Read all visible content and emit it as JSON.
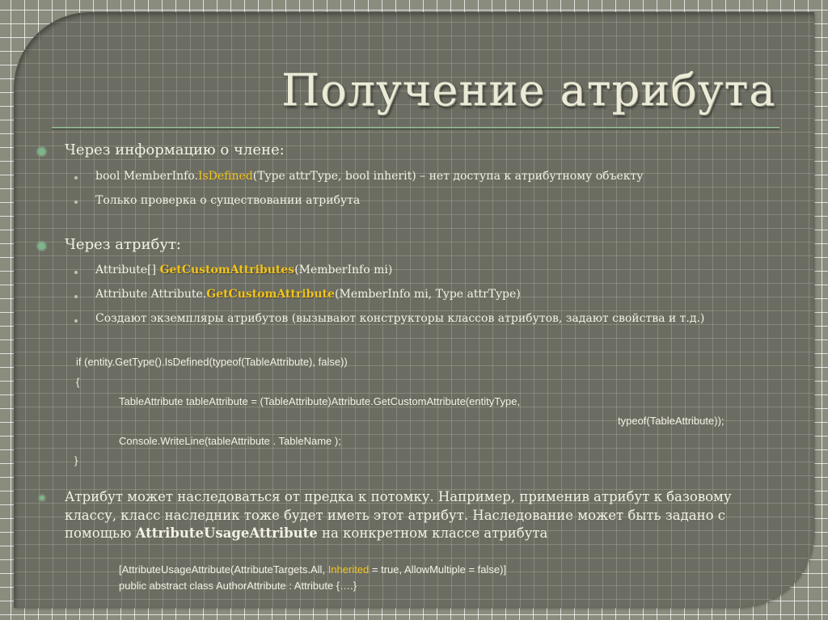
{
  "slide": {
    "title": "Получение атрибута",
    "colors": {
      "background": "#8a8c7e",
      "panel": "#6c6d62",
      "text": "#f2f1e6",
      "highlight": "#f2c318",
      "bullet": "#7fb58a"
    },
    "sections": [
      {
        "heading": "Через информацию о члене:",
        "items": [
          {
            "pre": "bool MemberInfo.",
            "highlight": "IsDefined",
            "post": "(Type attrType, bool inherit) – нет доступа к атрибутному объекту"
          },
          {
            "text": "Только проверка о существовании атрибута"
          }
        ]
      },
      {
        "heading": "Через атрибут:",
        "items": [
          {
            "pre": "Attribute[] ",
            "highlight": "GetCustomAttributes",
            "post": "(MemberInfo mi)"
          },
          {
            "pre": "Attribute Attribute.",
            "highlight": "GetCustomAttribute",
            "post": "(MemberInfo mi, Type attrType)"
          },
          {
            "text": "Создают экземпляры атрибутов (вызывают конструкторы классов атрибутов, задают свойства и т.д.)"
          }
        ]
      }
    ],
    "code_block_1": [
      "if (entity.GetType().IsDefined(typeof(TableAttribute), false))",
      "{",
      "TableAttribute tableAttribute = (TableAttribute)Attribute.GetCustomAttribute(entityType,",
      "typeof(TableAttribute));",
      "Console.WriteLine(tableAttribute . TableName );",
      "}"
    ],
    "paragraph": {
      "line1": "Атрибут может наследоваться от предка к потомку. Например, применив атрибут к базовому",
      "line2": "классу, класс наследник тоже будет иметь этот атрибут. Наследование может быть задано с",
      "line3_pre": "помощью ",
      "line3_bold": "AttributeUsageAttribute",
      "line3_post": " на конкретном классе атрибута"
    },
    "code_block_2": {
      "line1_pre": "[AttributeUsageAttribute(AttributeTargets.All, ",
      "line1_highlight": "Inherited",
      "line1_post": " = true, AllowMultiple = false)]",
      "line2": "public abstract class AuthorAttribute : Attribute {….}"
    }
  }
}
